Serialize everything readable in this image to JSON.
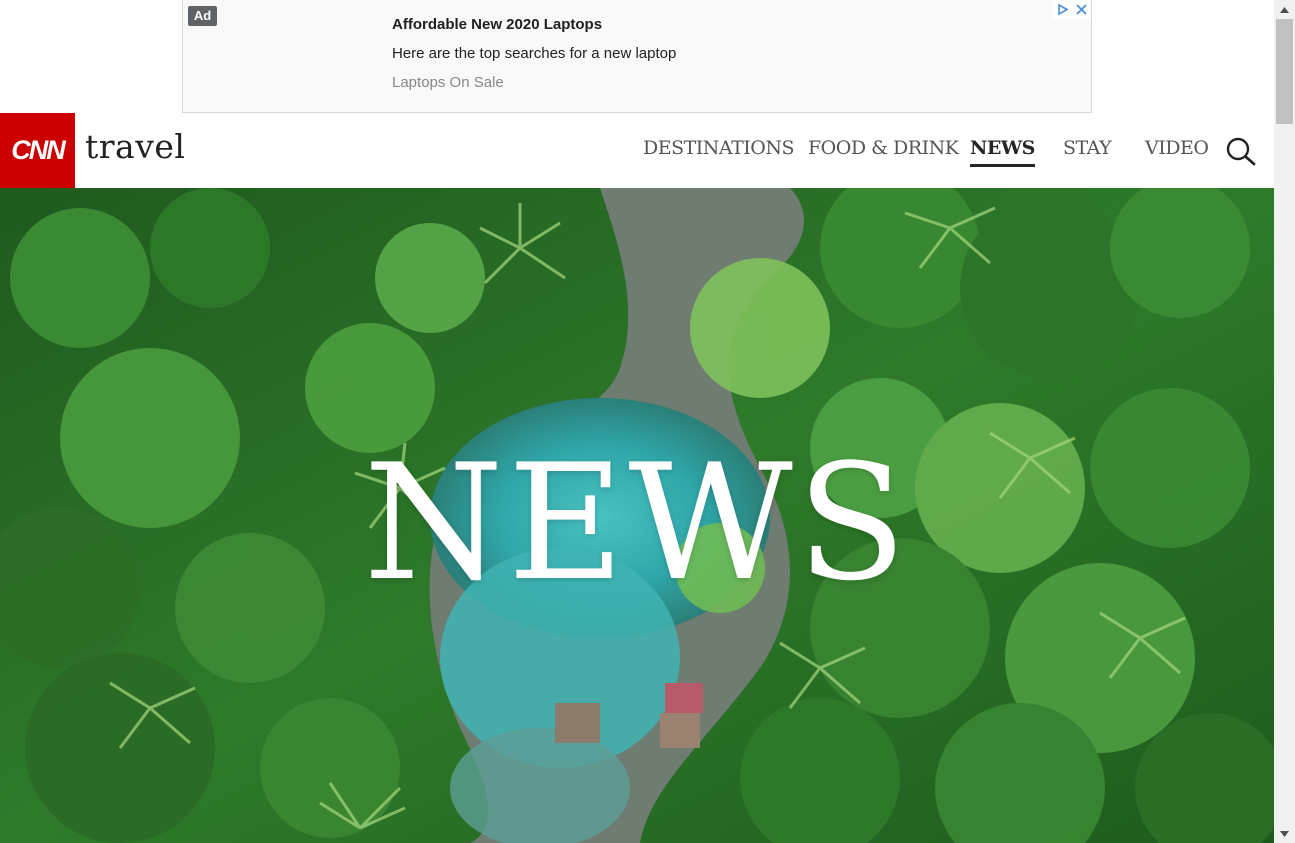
{
  "ad": {
    "badge": "Ad",
    "title": "Affordable New 2020 Laptops",
    "description": "Here are the top searches for a new laptop",
    "link": "Laptops On Sale"
  },
  "header": {
    "logo": "CNN",
    "brand": "travel",
    "nav": [
      {
        "label": "DESTINATIONS",
        "active": false
      },
      {
        "label": "FOOD & DRINK",
        "active": false
      },
      {
        "label": "NEWS",
        "active": true
      },
      {
        "label": "STAY",
        "active": false
      },
      {
        "label": "VIDEO",
        "active": false
      }
    ],
    "search_icon": "search-icon"
  },
  "hero": {
    "title": "NEWS"
  },
  "colors": {
    "brand_red": "#cc0000",
    "nav_text": "#555555",
    "nav_active": "#262626",
    "ad_info_blue": "#4a90d9"
  }
}
